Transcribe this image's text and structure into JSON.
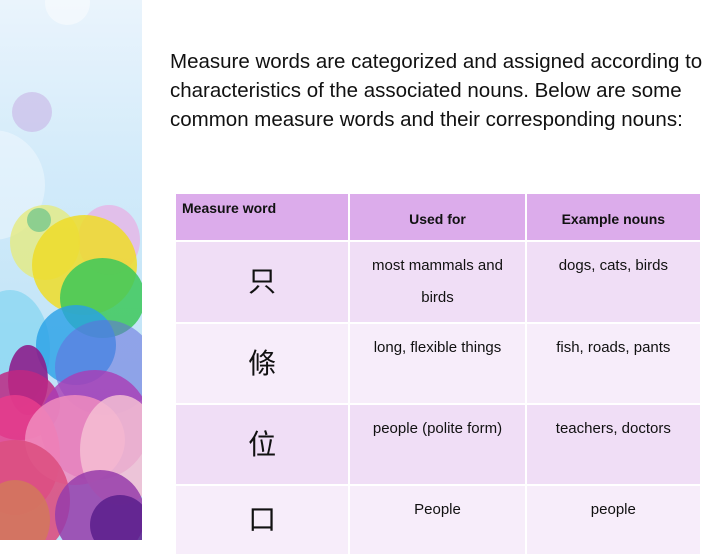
{
  "intro_text": "Measure words are categorized and assigned according to characteristics of the associated nouns. Below are some common measure words and their corresponding nouns:",
  "table": {
    "headers": [
      "Measure word",
      "Used for",
      "Example nouns"
    ],
    "rows": [
      {
        "measure_word": "只",
        "used_for": "most mammals and birds",
        "examples": "dogs, cats, birds"
      },
      {
        "measure_word": "條",
        "used_for": "long, flexible things",
        "examples": "fish, roads, pants"
      },
      {
        "measure_word": "位",
        "used_for": "people (polite form)",
        "examples": "teachers, doctors"
      },
      {
        "measure_word": "口",
        "used_for": "People",
        "examples": "people"
      }
    ]
  },
  "colors": {
    "header_bg": "#dcaceb",
    "row_odd_bg": "#f0def6",
    "row_even_bg": "#f7edfa"
  }
}
